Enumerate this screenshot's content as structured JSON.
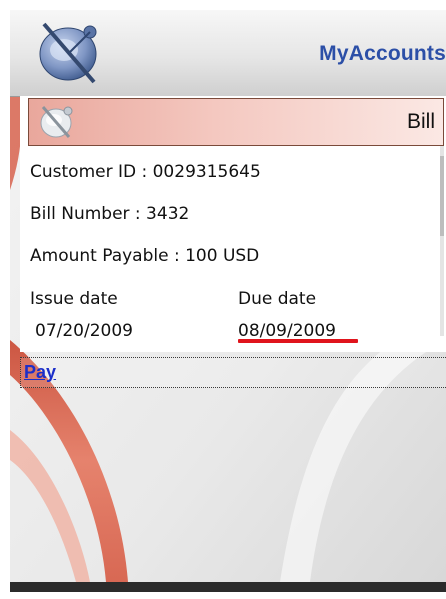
{
  "header": {
    "title": "MyAccounts",
    "logo_icon": "satellite-dish-logo-icon"
  },
  "bill": {
    "title": "Bill",
    "icon": "bill-icon",
    "customer_id": "Customer ID : 0029315645",
    "bill_number": "Bill Number : 3432",
    "amount_payable": "Amount Payable : 100 USD",
    "issue_date_label": "Issue date",
    "issue_date_value": "07/20/2009",
    "due_date_label": "Due date",
    "due_date_value": "08/09/2009",
    "highlight_color": "#e0141c"
  },
  "actions": {
    "pay_label": "Pay"
  },
  "colors": {
    "title_blue": "#2c4fa7",
    "link_blue": "#1b2ec9",
    "header_accent": "#e9a79c"
  }
}
